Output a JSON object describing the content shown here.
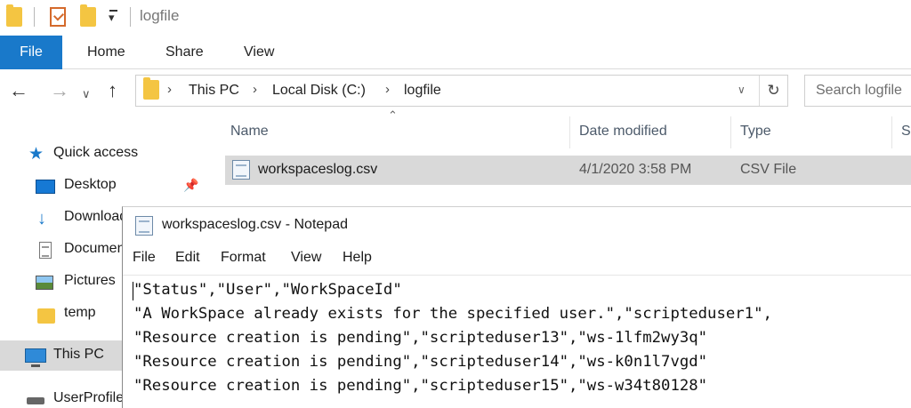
{
  "explorer": {
    "window_title": "logfile",
    "ribbon_tabs": [
      "File",
      "Home",
      "Share",
      "View"
    ],
    "address": {
      "crumbs": [
        "This PC",
        "Local Disk (C:)",
        "logfile"
      ]
    },
    "search": {
      "placeholder": "Search logfile"
    },
    "nav": [
      {
        "label": "Quick access",
        "icon": "star-icon"
      },
      {
        "label": "Desktop",
        "icon": "desktop-icon"
      },
      {
        "label": "Downloads",
        "icon": "download-icon"
      },
      {
        "label": "Documents",
        "icon": "documents-icon"
      },
      {
        "label": "Pictures",
        "icon": "pictures-icon"
      },
      {
        "label": "temp",
        "icon": "folder-icon"
      },
      {
        "label": "This PC",
        "icon": "computer-icon",
        "selected": true
      },
      {
        "label": "UserProfile",
        "icon": "drive-icon"
      }
    ],
    "columns": [
      "Name",
      "Date modified",
      "Type",
      "Size"
    ],
    "files": [
      {
        "name": "workspaceslog.csv",
        "date_modified": "4/1/2020 3:58 PM",
        "type": "CSV File"
      }
    ],
    "colors": {
      "accent": "#1979ca",
      "selection": "#d9d9d9"
    }
  },
  "notepad": {
    "title": "workspaceslog.csv - Notepad",
    "menu": [
      "File",
      "Edit",
      "Format",
      "View",
      "Help"
    ],
    "lines": [
      "\"Status\",\"User\",\"WorkSpaceId\"",
      "\"A WorkSpace already exists for the specified user.\",\"scripteduser1\",",
      "\"Resource creation is pending\",\"scripteduser13\",\"ws-1lfm2wy3q\"",
      "\"Resource creation is pending\",\"scripteduser14\",\"ws-k0n1l7vgd\"",
      "\"Resource creation is pending\",\"scripteduser15\",\"ws-w34t80128\""
    ]
  }
}
